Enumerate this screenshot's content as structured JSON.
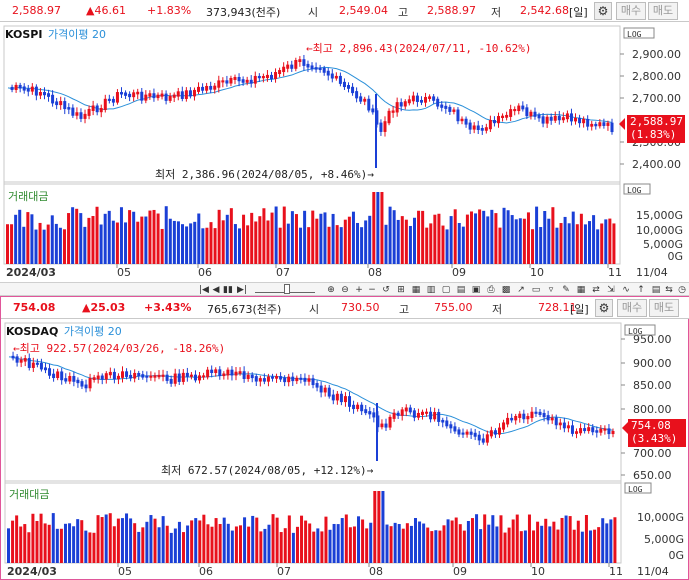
{
  "kospi": {
    "quote": {
      "price": "2,588.97",
      "change": "▲46.61",
      "rate": "+1.83%",
      "volume": "373,943(천주)",
      "open_label": "시",
      "open": "2,549.04",
      "high_label": "고",
      "high": "2,588.97",
      "low_label": "저",
      "low": "2,542.68",
      "period": "[일]",
      "buy": "매수",
      "sell": "매도"
    },
    "index_name": "KOSPI",
    "ma_label": "가격이평 20",
    "volume_label": "거래대금",
    "annotation_high": "←최고 2,896.43(2024/07/11, -10.62%)",
    "annotation_low": "최저 2,386.96(2024/08/05, +8.46%)→",
    "current_price_tag": "2,588.97",
    "current_rate_tag": "(1.83%)",
    "price_ticks": [
      "2,900.00",
      "2,800.00",
      "2,700.00",
      "2,500.00",
      "2,400.00"
    ],
    "volume_ticks": [
      "15,000G",
      "10,000G",
      "5,000G",
      "0G"
    ],
    "date_labels": [
      "2024/03",
      "05",
      "06",
      "07",
      "08",
      "09",
      "10",
      "11",
      "11/04"
    ],
    "scale_box": "LOG",
    "vol_box": "LOG"
  },
  "kosdaq": {
    "quote": {
      "price": "754.08",
      "change": "▲25.03",
      "rate": "+3.43%",
      "volume": "765,673(천주)",
      "open_label": "시",
      "open": "730.50",
      "high_label": "고",
      "high": "755.00",
      "low_label": "저",
      "low": "728.11",
      "period": "[일]",
      "buy": "매수",
      "sell": "매도"
    },
    "index_name": "KOSDAQ",
    "ma_label": "가격이평 20",
    "volume_label": "거래대금",
    "annotation_high": "←최고 922.57(2024/03/26, -18.26%)",
    "annotation_low": "최저 672.57(2024/08/05, +12.12%)→",
    "current_price_tag": "754.08",
    "current_rate_tag": "(3.43%)",
    "price_ticks": [
      "950.00",
      "900.00",
      "850.00",
      "800.00",
      "700.00",
      "650.00"
    ],
    "volume_ticks": [
      "10,000G",
      "5,000G",
      "0G"
    ],
    "date_labels": [
      "2024/03",
      "05",
      "06",
      "07",
      "08",
      "09",
      "10",
      "11",
      "11/04"
    ],
    "scale_box": "LOG",
    "vol_box": "LOG"
  },
  "colors": {
    "up": "#e8101c",
    "down": "#1a3fd6",
    "ma": "#2b90d9",
    "accent": "#e0569a"
  },
  "icons": [
    "gear-icon",
    "play-icon",
    "pause-icon",
    "zoom-in-icon",
    "zoom-out-icon",
    "reset-icon",
    "clock-icon"
  ]
}
